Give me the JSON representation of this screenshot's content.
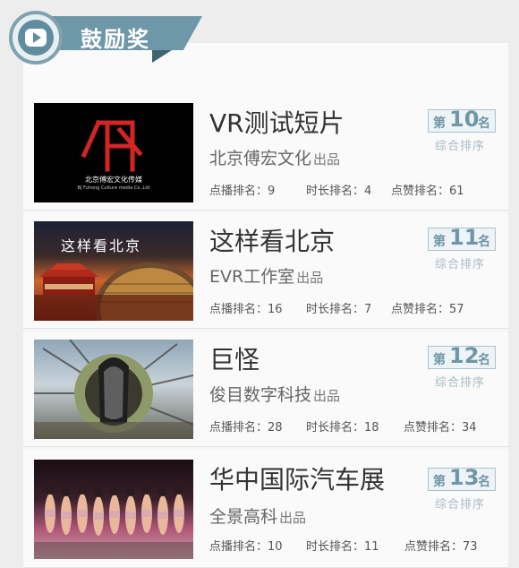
{
  "header": {
    "title": "鼓励奖",
    "badge_icon": "play-icon"
  },
  "colors": {
    "accent": "#6e97a7",
    "accent_dark": "#3f6575",
    "text_main": "#333333",
    "text_sub": "#666666"
  },
  "items": [
    {
      "title": "VR测试短片",
      "producer": "北京傅宏文化",
      "producer_suffix": "出品",
      "rank_prefix": "第",
      "rank_number": "10",
      "rank_suffix": "名",
      "rank_sub": "综合排序",
      "stats": [
        "点播排名：9",
        "时长排名：4",
        "点赞排名：61"
      ],
      "thumb": {
        "caption": "北京傅宏文化传媒",
        "caption_small": "BJ Fuhong Culture media Co.,Ltd"
      }
    },
    {
      "title": "这样看北京",
      "producer": "EVR工作室",
      "producer_suffix": "出品",
      "rank_prefix": "第",
      "rank_number": "11",
      "rank_suffix": "名",
      "rank_sub": "综合排序",
      "stats": [
        "点播排名：16",
        "时长排名：7",
        "点赞排名：57"
      ],
      "thumb": {
        "caption": "这样看北京"
      }
    },
    {
      "title": "巨怪",
      "producer": "俊目数字科技",
      "producer_suffix": "出品",
      "rank_prefix": "第",
      "rank_number": "12",
      "rank_suffix": "名",
      "rank_sub": "综合排序",
      "stats": [
        "点播排名：28",
        "时长排名：18",
        "点赞排名：34"
      ]
    },
    {
      "title": "华中国际汽车展",
      "producer": "全景高科",
      "producer_suffix": "出品",
      "rank_prefix": "第",
      "rank_number": "13",
      "rank_suffix": "名",
      "rank_sub": "综合排序",
      "stats": [
        "点播排名：10",
        "时长排名：11",
        "点赞排名：73"
      ]
    }
  ]
}
